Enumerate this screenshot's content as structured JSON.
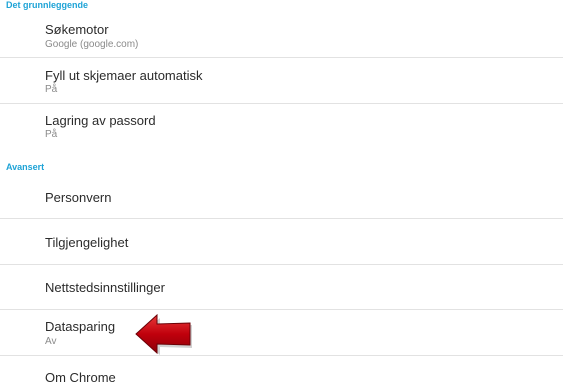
{
  "sections": {
    "basic_header": "Det grunnleggende",
    "advanced_header": "Avansert"
  },
  "rows": {
    "search_engine": {
      "title": "Søkemotor",
      "subtitle": "Google (google.com)"
    },
    "autofill": {
      "title": "Fyll ut skjemaer automatisk",
      "subtitle": "På"
    },
    "save_passwords": {
      "title": "Lagring av passord",
      "subtitle": "På"
    },
    "privacy": {
      "title": "Personvern"
    },
    "accessibility": {
      "title": "Tilgjengelighet"
    },
    "site_settings": {
      "title": "Nettstedsinnstillinger"
    },
    "data_saver": {
      "title": "Datasparing",
      "subtitle": "Av"
    },
    "about_chrome": {
      "title": "Om Chrome"
    }
  },
  "colors": {
    "section_header": "#1ea3d6",
    "arrow": "#c0000c"
  },
  "icons": {
    "pointer": "red-arrow-icon"
  }
}
